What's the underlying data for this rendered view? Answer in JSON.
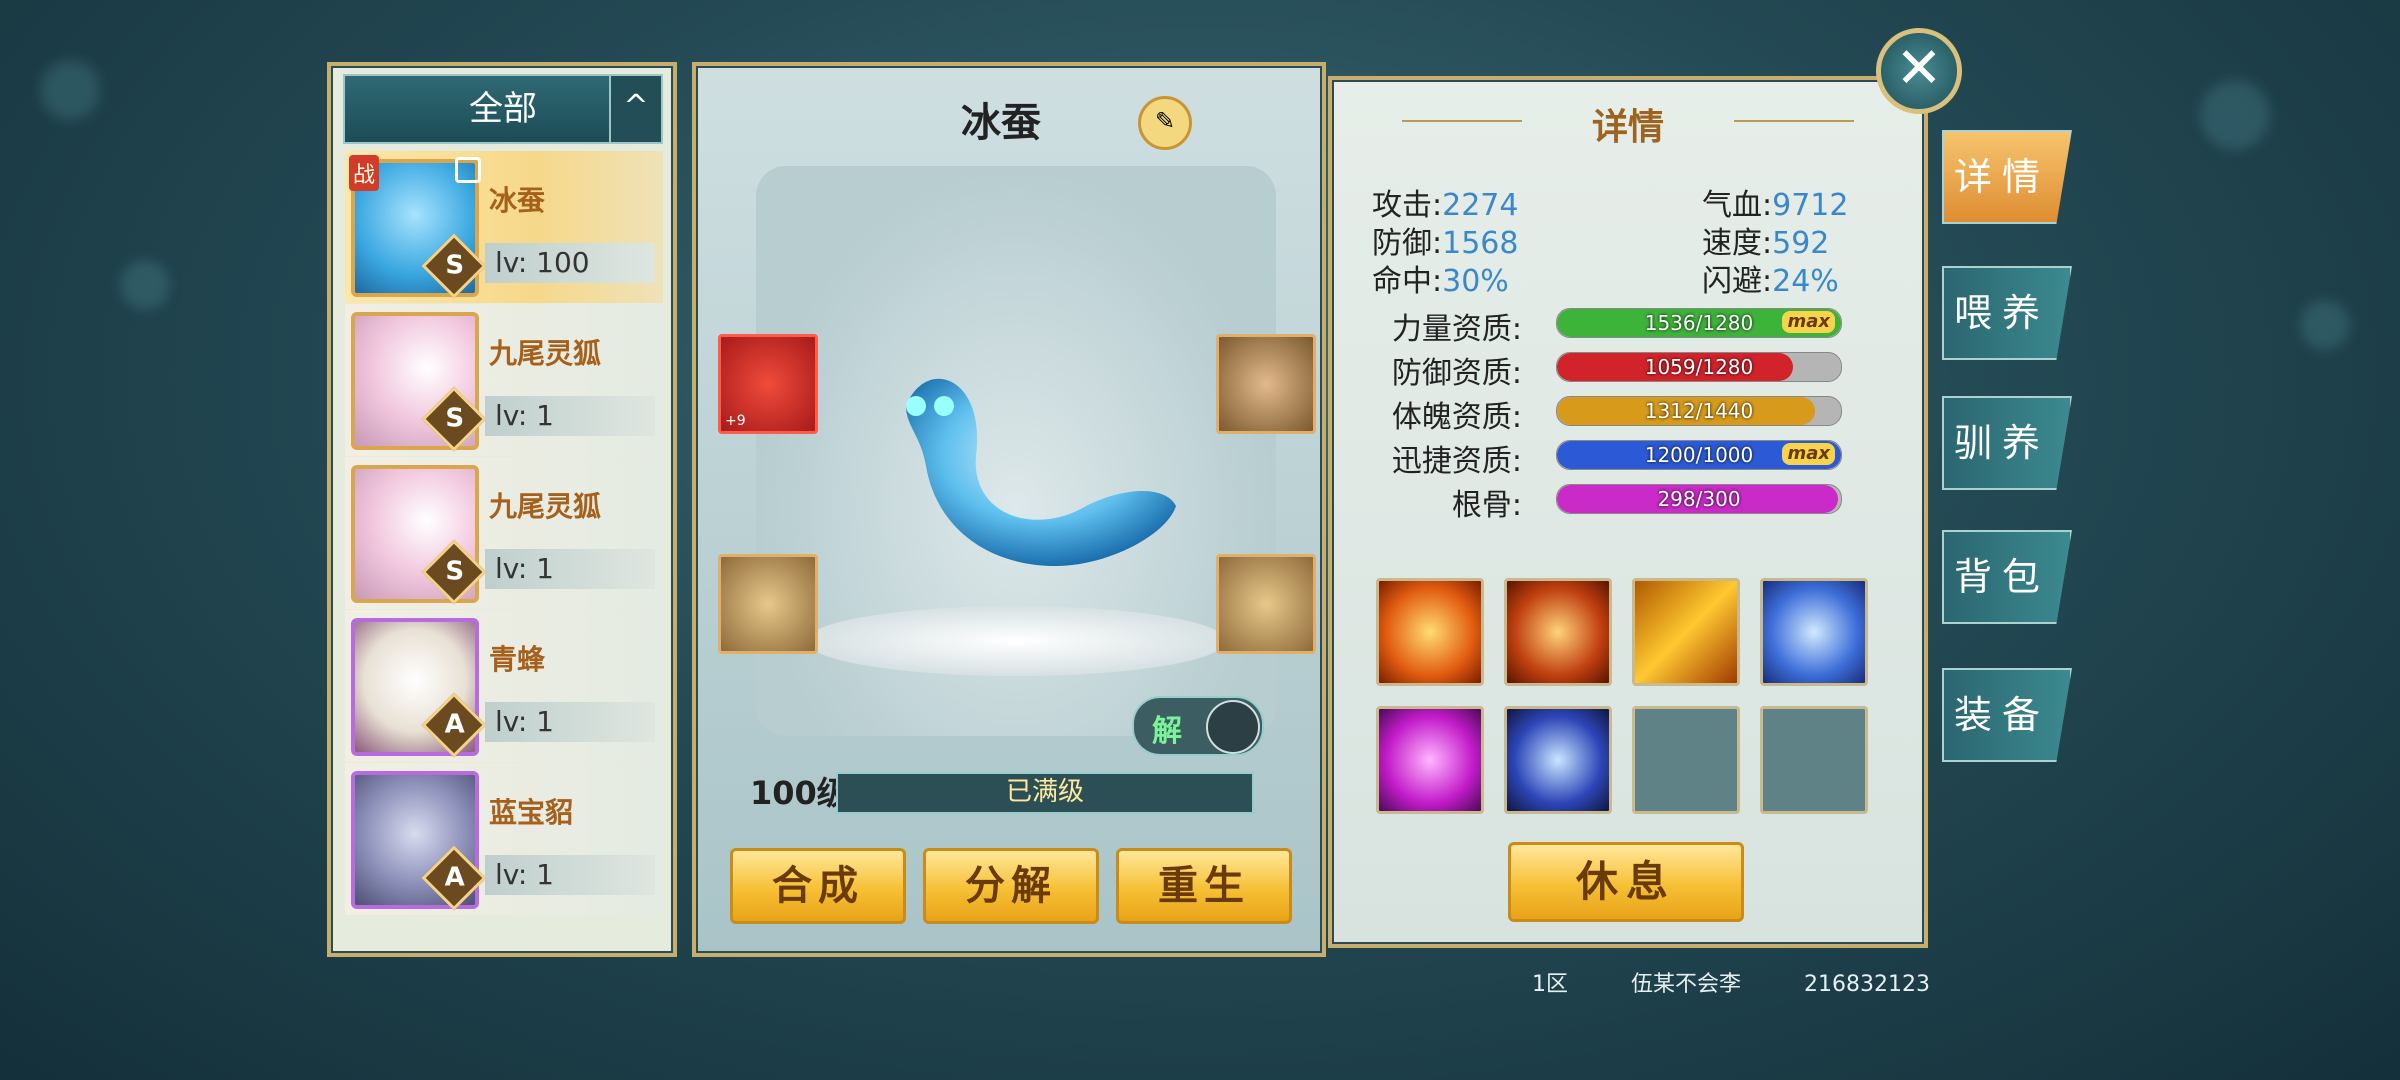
{
  "filter": {
    "label": "全部",
    "toggle_icon": "^"
  },
  "pets": [
    {
      "name": "冰蚕",
      "level": "lv: 100",
      "grade": "S",
      "selected": true,
      "badge": "战"
    },
    {
      "name": "九尾灵狐",
      "level": "lv: 1",
      "grade": "S"
    },
    {
      "name": "九尾灵狐",
      "level": "lv: 1",
      "grade": "S"
    },
    {
      "name": "青蜂",
      "level": "lv: 1",
      "grade": "A"
    },
    {
      "name": "蓝宝貂",
      "level": "lv: 1",
      "grade": "A"
    }
  ],
  "center": {
    "pet_title": "冰蚕",
    "rename_icon": "edit-icon",
    "equip_top_left_plus": "+9",
    "unlock_label": "解",
    "level_label": "100级",
    "level_bar_text": "已满级",
    "buttons": {
      "compose": "合成",
      "decompose": "分解",
      "rebirth": "重生"
    }
  },
  "details": {
    "title": "详情",
    "stats": {
      "attack_label": "攻击:",
      "attack": "2274",
      "hp_label": "气血:",
      "hp": "9712",
      "defense_label": "防御:",
      "defense": "1568",
      "speed_label": "速度:",
      "speed": "592",
      "hit_label": "命中:",
      "hit": "30%",
      "dodge_label": "闪避:",
      "dodge": "24%"
    },
    "aptitudes": [
      {
        "label": "力量资质:",
        "text": "1536/1280",
        "fill": 1.0,
        "color": "#3db33a",
        "max": "max"
      },
      {
        "label": "防御资质:",
        "text": "1059/1280",
        "fill": 0.83,
        "color": "#d2222a"
      },
      {
        "label": "体魄资质:",
        "text": "1312/1440",
        "fill": 0.91,
        "color": "#d79a1b"
      },
      {
        "label": "迅捷资质:",
        "text": "1200/1000",
        "fill": 1.0,
        "color": "#2c5ad6",
        "max": "max"
      },
      {
        "label": "根骨:",
        "text": "298/300",
        "fill": 0.99,
        "color": "#c92ac8"
      }
    ],
    "rest_button": "休息"
  },
  "side_tabs": [
    "详情",
    "喂养",
    "驯养",
    "背包",
    "装备"
  ],
  "footer": {
    "server": "1区",
    "player": "伍某不会李",
    "id": "216832123"
  },
  "close_icon": "close-icon"
}
